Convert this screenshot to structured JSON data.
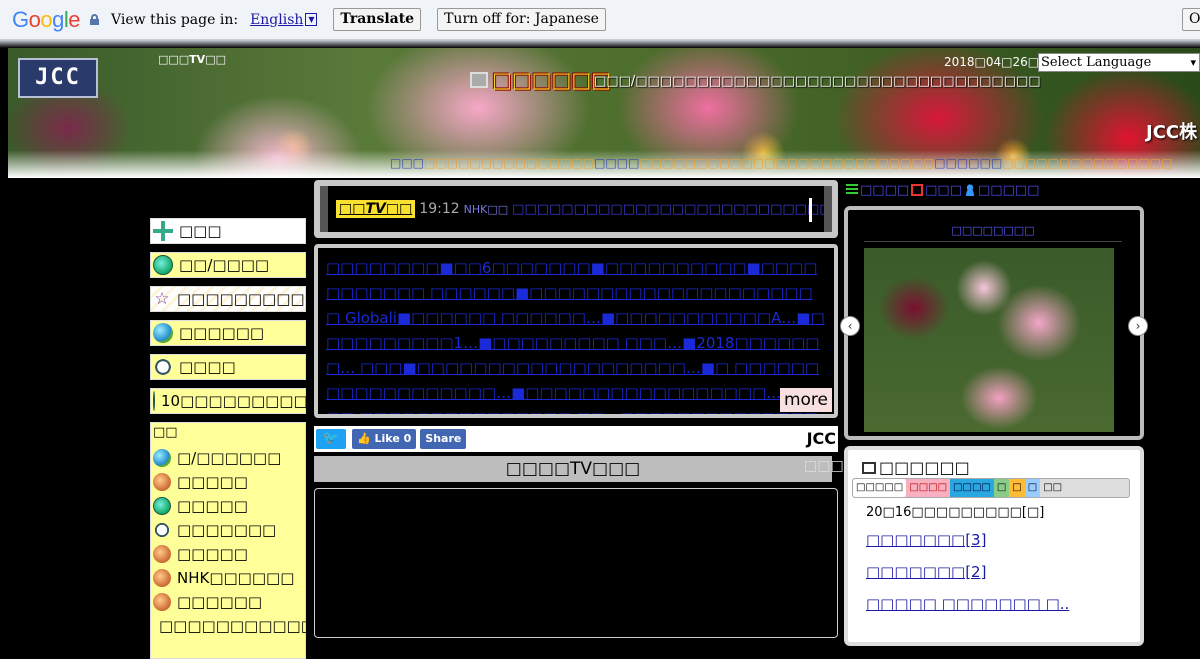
{
  "translate_bar": {
    "logo": [
      "G",
      "o",
      "o",
      "g",
      "l",
      "e"
    ],
    "prompt": "View this page in:",
    "language": "English",
    "translate_label": "Translate",
    "turn_off_label": "Turn off for: Japanese",
    "options_label": "Op"
  },
  "header": {
    "tv_label": "□□□TV□□",
    "title": "□□□□□□",
    "subtitle": "□□□/□□□□□□□□□□□□□□□□□□□□□□□□□□□□□□□□□",
    "date": "2018□04□26□(□)",
    "select_language": "Select Language",
    "corner": "JCC株",
    "logo": "JCC",
    "marquee_1": "□□□",
    "marquee_2": "□□□□□□□□□□□□□□□",
    "marquee_3": "□□□□",
    "marquee_4": "□□□□□□□□□□□□□□□□□□□□□□□□□□",
    "marquee_5": "□□□□□□",
    "marquee_6": "□□□□□□□□□□□□□□□"
  },
  "sidebar": {
    "items": [
      {
        "label": "□□□",
        "icon": "crosshair-icon"
      },
      {
        "label": "□□/□□□□",
        "icon": "globe-icon"
      },
      {
        "label": "□□□□□□□□□",
        "icon": "star-icon"
      },
      {
        "label": "□□□□□□",
        "icon": "earth-icon"
      },
      {
        "label": "□□□□",
        "icon": "bicycle-icon"
      },
      {
        "label": "10□□□□□□□□□",
        "icon": "globe-icon"
      }
    ],
    "group_title": "□□",
    "sub_items": [
      {
        "label": "□/□□□□□□",
        "icon": "earth-icon"
      },
      {
        "label": "□□□□□",
        "icon": "chart-icon"
      },
      {
        "label": "□□□□□",
        "icon": "broccoli-icon"
      },
      {
        "label": "□□□□□□□",
        "icon": "baseball-icon"
      },
      {
        "label": "□□□□□",
        "icon": "building-icon"
      },
      {
        "label": "NHK□□□□□□",
        "icon": "people-icon"
      },
      {
        "label": "□□□□□□",
        "icon": "city-icon"
      },
      {
        "label": "□□□□□□□□□□□",
        "icon": "pin-icon"
      }
    ]
  },
  "tv_ticker": {
    "badge": "□□TV□□",
    "time": "19:12",
    "channel": "NHK□□",
    "headline": "□□□□□□□□□□□□□□□□□□□□□□□□□□□□"
  },
  "news": {
    "text": "□□□□□□□□■□□6□□□□□□□■□□□□□□□□□□■□□□□□□□□□□□ □□□□□□■□□□□□□□□□□□□□□□□□□□□□ Globali■□□□□□□ □□□□□□…■□□□□□□□□□□□A…■□□□□□□□□□□1…■□□□□□□□□□ □□□…■2018□□□□□□□… □□□■□□□□□□□□□□□□□□□□□□□…■□ □□□□□□□□□□□□□□□□□□…■□□□□□□□□□□□□□□□□□… □□□■ □□□□□□□□□□□□□□□ □□…■□□□□□□□□□□□□□□□□□□□□□□□□□",
    "more": "more"
  },
  "share": {
    "twitter": "t",
    "like": "Like 0",
    "share": "Share",
    "brand": "JCC",
    "brand_sub": "□□□"
  },
  "live": {
    "title": "□□□□TV□□□"
  },
  "right": {
    "tab_1": "□□□□",
    "tab_2": "□□□",
    "tab_3": "□□□□□",
    "slider_title": "□□□□□□□□",
    "program_title": "□□□□□□",
    "program_tabs": [
      "□□□□□",
      "□□□□",
      "□□□□",
      "□",
      "□",
      "□",
      "□□"
    ],
    "program_items": [
      "20□16□□□□□□□□□[□]",
      "□□□□□□□[3]",
      "□□□□□□□[2]",
      "□□□□□ □□□□□□□ □.."
    ]
  },
  "colors": {
    "accent_yellow": "#ffff99",
    "link_blue": "#1a2ad8",
    "background": "#000000"
  }
}
